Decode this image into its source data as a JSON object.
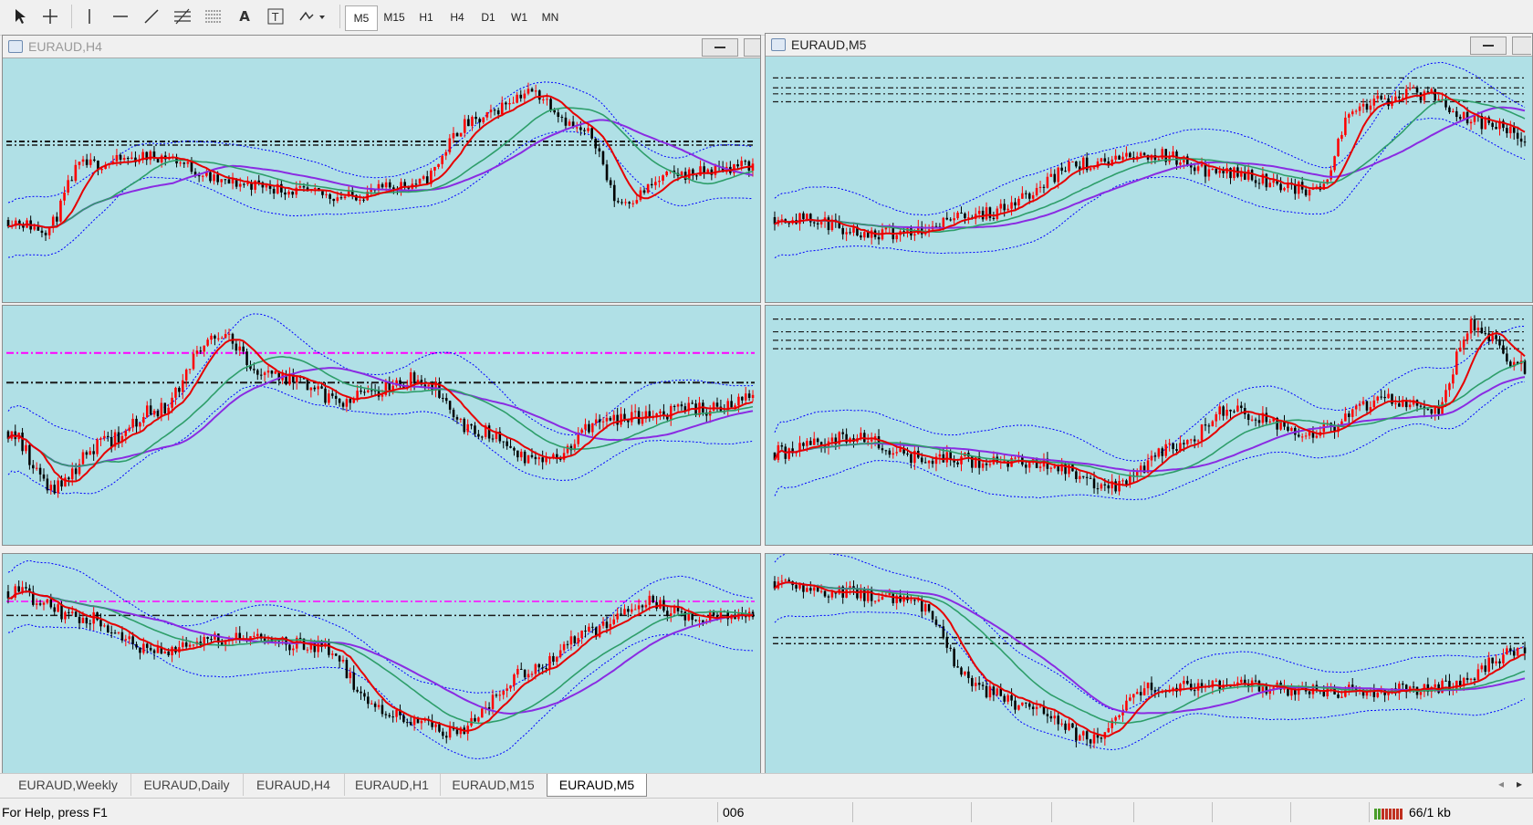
{
  "toolbar": {
    "tools": [
      {
        "name": "cursor-icon",
        "glyph": "↖"
      },
      {
        "name": "crosshair-icon",
        "glyph": "✚"
      },
      {
        "name": "vertical-line-icon",
        "glyph": "|"
      },
      {
        "name": "horizontal-line-icon",
        "glyph": "—"
      },
      {
        "name": "trendline-icon",
        "glyph": "∕"
      },
      {
        "name": "fibonacci-icon",
        "glyph": "≡"
      },
      {
        "name": "grid-lines-icon",
        "glyph": "≣"
      },
      {
        "name": "text-icon",
        "glyph": "A"
      },
      {
        "name": "text-label-icon",
        "glyph": "T"
      },
      {
        "name": "shapes-dropdown-icon",
        "glyph": "▾"
      }
    ],
    "timeframes": [
      "M5",
      "M15",
      "H1",
      "H4",
      "D1",
      "W1",
      "MN"
    ],
    "active_timeframe": "M5"
  },
  "windows": {
    "top_left_title": "EURAUD,H4",
    "top_right_title": "EURAUD,M5"
  },
  "colors": {
    "chart_bg": "#b0e0e6",
    "bull": "#ff0000",
    "bear": "#000000",
    "ma_fast": "#e60000",
    "ma_mid": "#2e9e6a",
    "ma_slow": "#8a2be2",
    "bands": "#0000ff",
    "magenta_level": "#ff00ff"
  },
  "tabs": [
    "EURAUD,Weekly",
    "EURAUD,Daily",
    "EURAUD,H4",
    "EURAUD,H1",
    "EURAUD,M15",
    "EURAUD,M5"
  ],
  "active_tab": "EURAUD,M5",
  "status": {
    "help": "For Help, press F1",
    "profile": "006",
    "traffic": "66/1 kb"
  }
}
